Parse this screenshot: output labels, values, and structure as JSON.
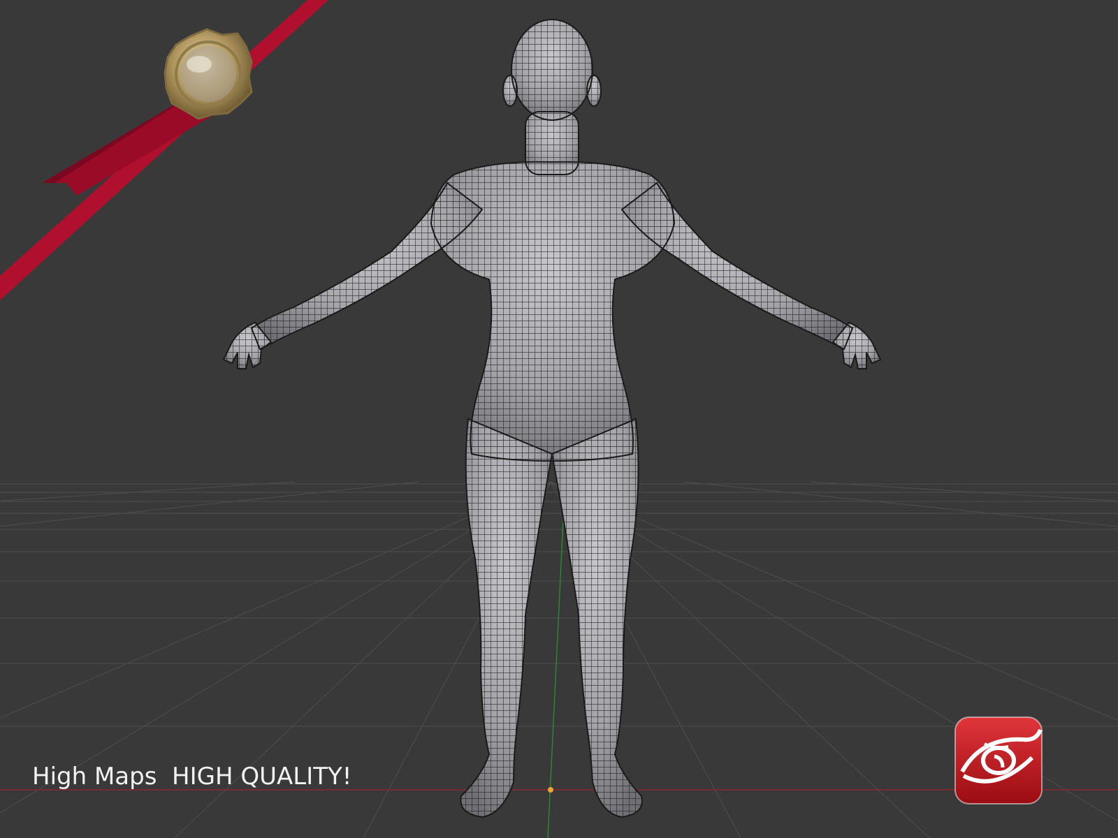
{
  "viewport": {
    "background": "#393939",
    "grid_color": "#4a4a4a",
    "x_axis_color": "#8a2630",
    "y_axis_color": "#2e8a2e",
    "mesh_fill": "#a9a9ad",
    "mesh_wire": "#141414"
  },
  "decor": {
    "ribbon_color": "#b0102e",
    "seal_color": "#c9b27c",
    "seal_icon": "wax-seal-icon"
  },
  "caption": {
    "text": "High Maps  HIGH QUALITY!"
  },
  "badge": {
    "icon": "eye-logo-icon",
    "color": "#c4161c"
  },
  "origin_marker": {
    "color": "#e8a33a"
  }
}
